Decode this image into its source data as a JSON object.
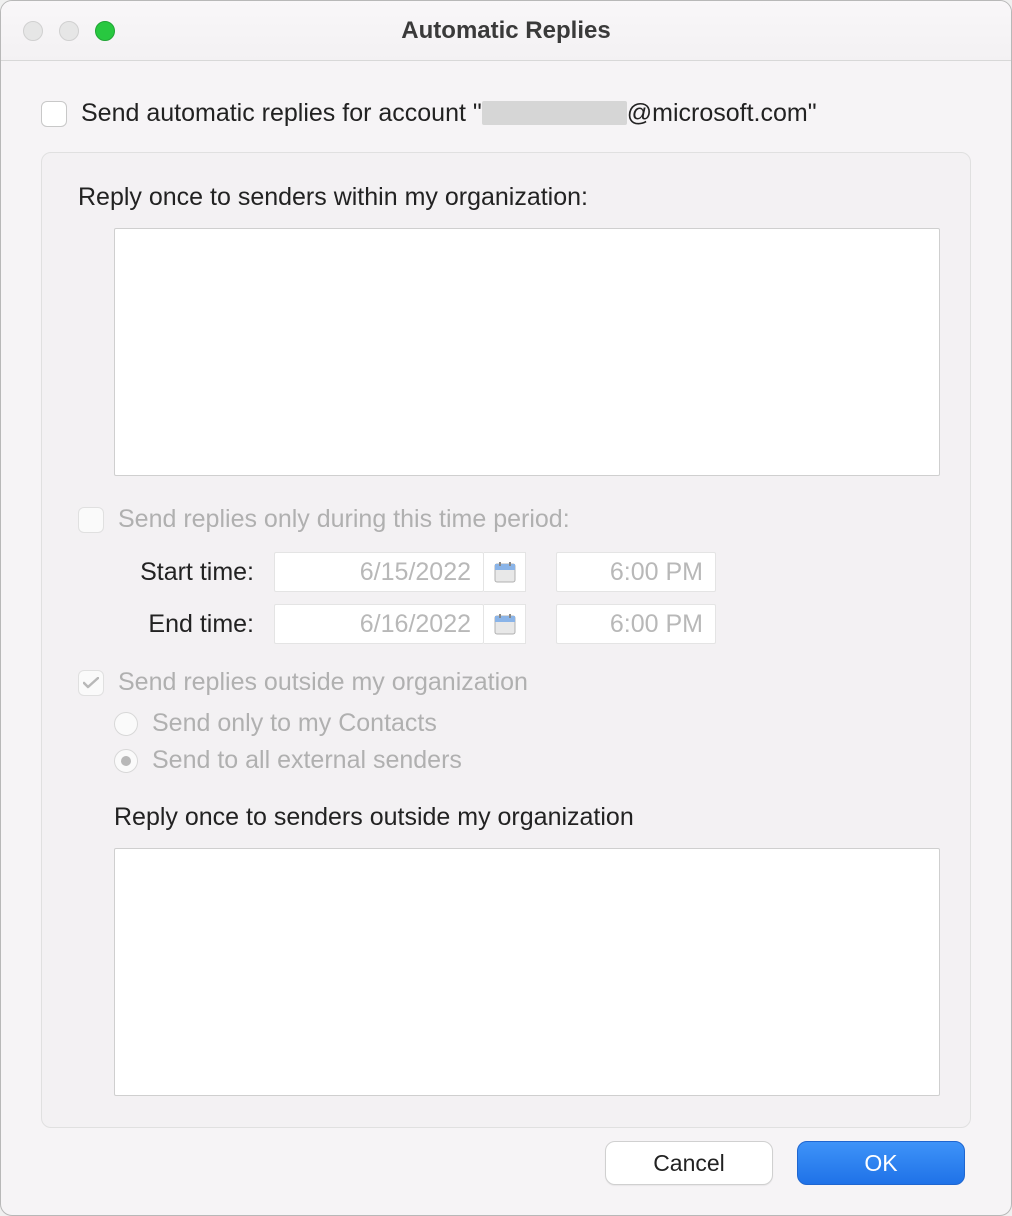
{
  "window": {
    "title": "Automatic Replies"
  },
  "main": {
    "send_auto_label_prefix": "Send automatic replies for account \"",
    "account_domain": "@microsoft.com",
    "send_auto_label_suffix": "\"",
    "reply_within_label": "Reply once to senders within my organization:",
    "internal_message": "",
    "time_period_label": "Send replies only during this time period:",
    "start_label": "Start time:",
    "start_date": "6/15/2022",
    "start_time": "6:00 PM",
    "end_label": "End time:",
    "end_date": "6/16/2022",
    "end_time": "6:00 PM",
    "outside_chk_label": "Send replies outside my organization",
    "radio_contacts": "Send only to my Contacts",
    "radio_all": "Send to all external senders",
    "reply_outside_label": "Reply once to senders outside my organization",
    "external_message": ""
  },
  "footer": {
    "cancel": "Cancel",
    "ok": "OK"
  }
}
